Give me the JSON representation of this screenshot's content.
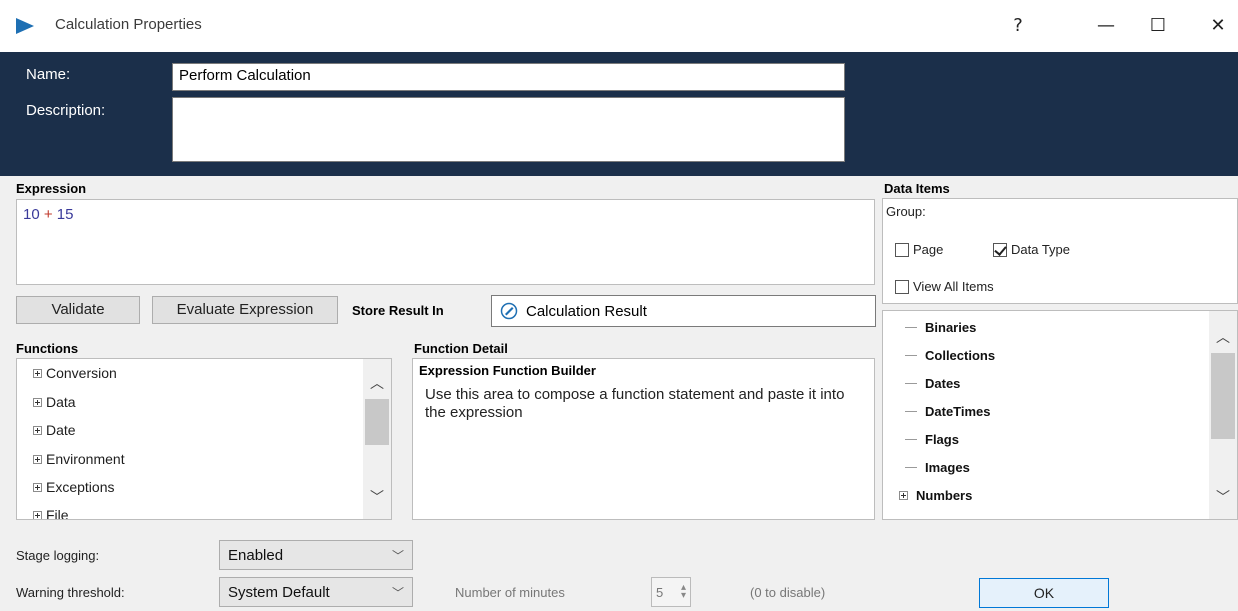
{
  "window": {
    "title": "Calculation Properties",
    "help": "?",
    "minimize": "—",
    "maximize": "☐",
    "close": "✕"
  },
  "header": {
    "name_label": "Name:",
    "name_value": "Perform Calculation",
    "description_label": "Description:",
    "description_value": ""
  },
  "expression": {
    "label": "Expression",
    "value_left": "10",
    "operator": "+",
    "value_right": "15"
  },
  "buttons": {
    "validate": "Validate",
    "evaluate": "Evaluate Expression"
  },
  "store_result": {
    "label": "Store Result In",
    "value": "Calculation Result"
  },
  "functions": {
    "label": "Functions",
    "items": [
      "Conversion",
      "Data",
      "Date",
      "Environment",
      "Exceptions",
      "File"
    ]
  },
  "function_detail": {
    "label": "Function Detail",
    "heading": "Expression Function Builder",
    "body": "Use this area to compose a function statement and paste it into the expression"
  },
  "data_items": {
    "label": "Data Items",
    "group_label": "Group:",
    "page_label": "Page",
    "page_checked": false,
    "data_type_label": "Data Type",
    "data_type_checked": true,
    "view_all_label": "View All Items",
    "view_all_checked": false,
    "items": [
      "Binaries",
      "Collections",
      "Dates",
      "DateTimes",
      "Flags",
      "Images",
      "Numbers"
    ]
  },
  "footer": {
    "stage_logging_label": "Stage logging:",
    "stage_logging_value": "Enabled",
    "warning_threshold_label": "Warning threshold:",
    "warning_threshold_value": "System Default",
    "minutes_label": "Number of minutes",
    "minutes_value": "5",
    "disable_hint": "(0 to disable)",
    "ok": "OK"
  },
  "colors": {
    "header_bg": "#1b2f4a",
    "expression_number": "#3a3a9a",
    "expression_operator": "#c0392b",
    "app_icon": "#1e6fb3"
  }
}
